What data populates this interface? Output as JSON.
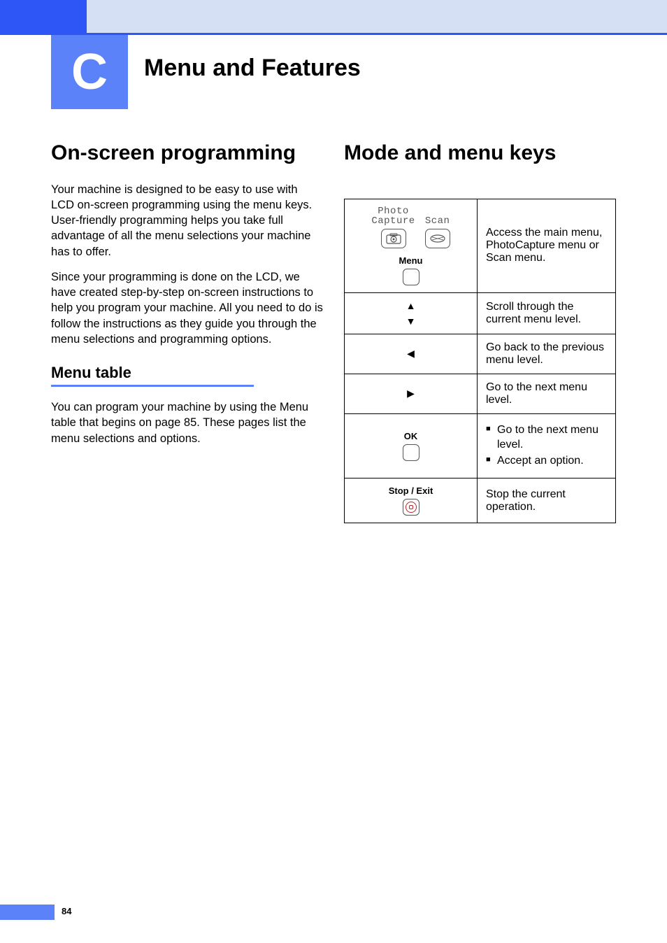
{
  "chapter": {
    "letter": "C",
    "title": "Menu and Features"
  },
  "left": {
    "heading": "On-screen programming",
    "para1": "Your machine is designed to be easy to use with LCD on-screen programming using the menu keys. User-friendly programming helps you take full advantage of all the menu selections your machine has to offer.",
    "para2": "Since your programming is done on the LCD, we have created step-by-step on-screen instructions to help you program your machine. All you need to do is follow the instructions as they guide you through the menu selections and programming options.",
    "subheading": "Menu table",
    "para3": "You can program your machine by using the Menu table that begins on page 85. These pages list the menu selections and options."
  },
  "right": {
    "heading": "Mode and menu keys",
    "rows": [
      {
        "key_type": "menu-block",
        "labels": {
          "photo": "Photo",
          "capture": "Capture",
          "scan": "Scan",
          "menu": "Menu"
        },
        "desc": "Access the main menu, PhotoCapture menu or Scan menu."
      },
      {
        "key_type": "updown",
        "desc": "Scroll through the current menu level."
      },
      {
        "key_type": "left",
        "desc": "Go back to the previous menu level."
      },
      {
        "key_type": "rightarrow",
        "desc": "Go to the next menu level."
      },
      {
        "key_type": "ok",
        "label": "OK",
        "bullets": [
          "Go to the next menu level.",
          "Accept an option."
        ]
      },
      {
        "key_type": "stop",
        "label": "Stop / Exit",
        "desc": "Stop the current operation."
      }
    ]
  },
  "page_number": "84"
}
